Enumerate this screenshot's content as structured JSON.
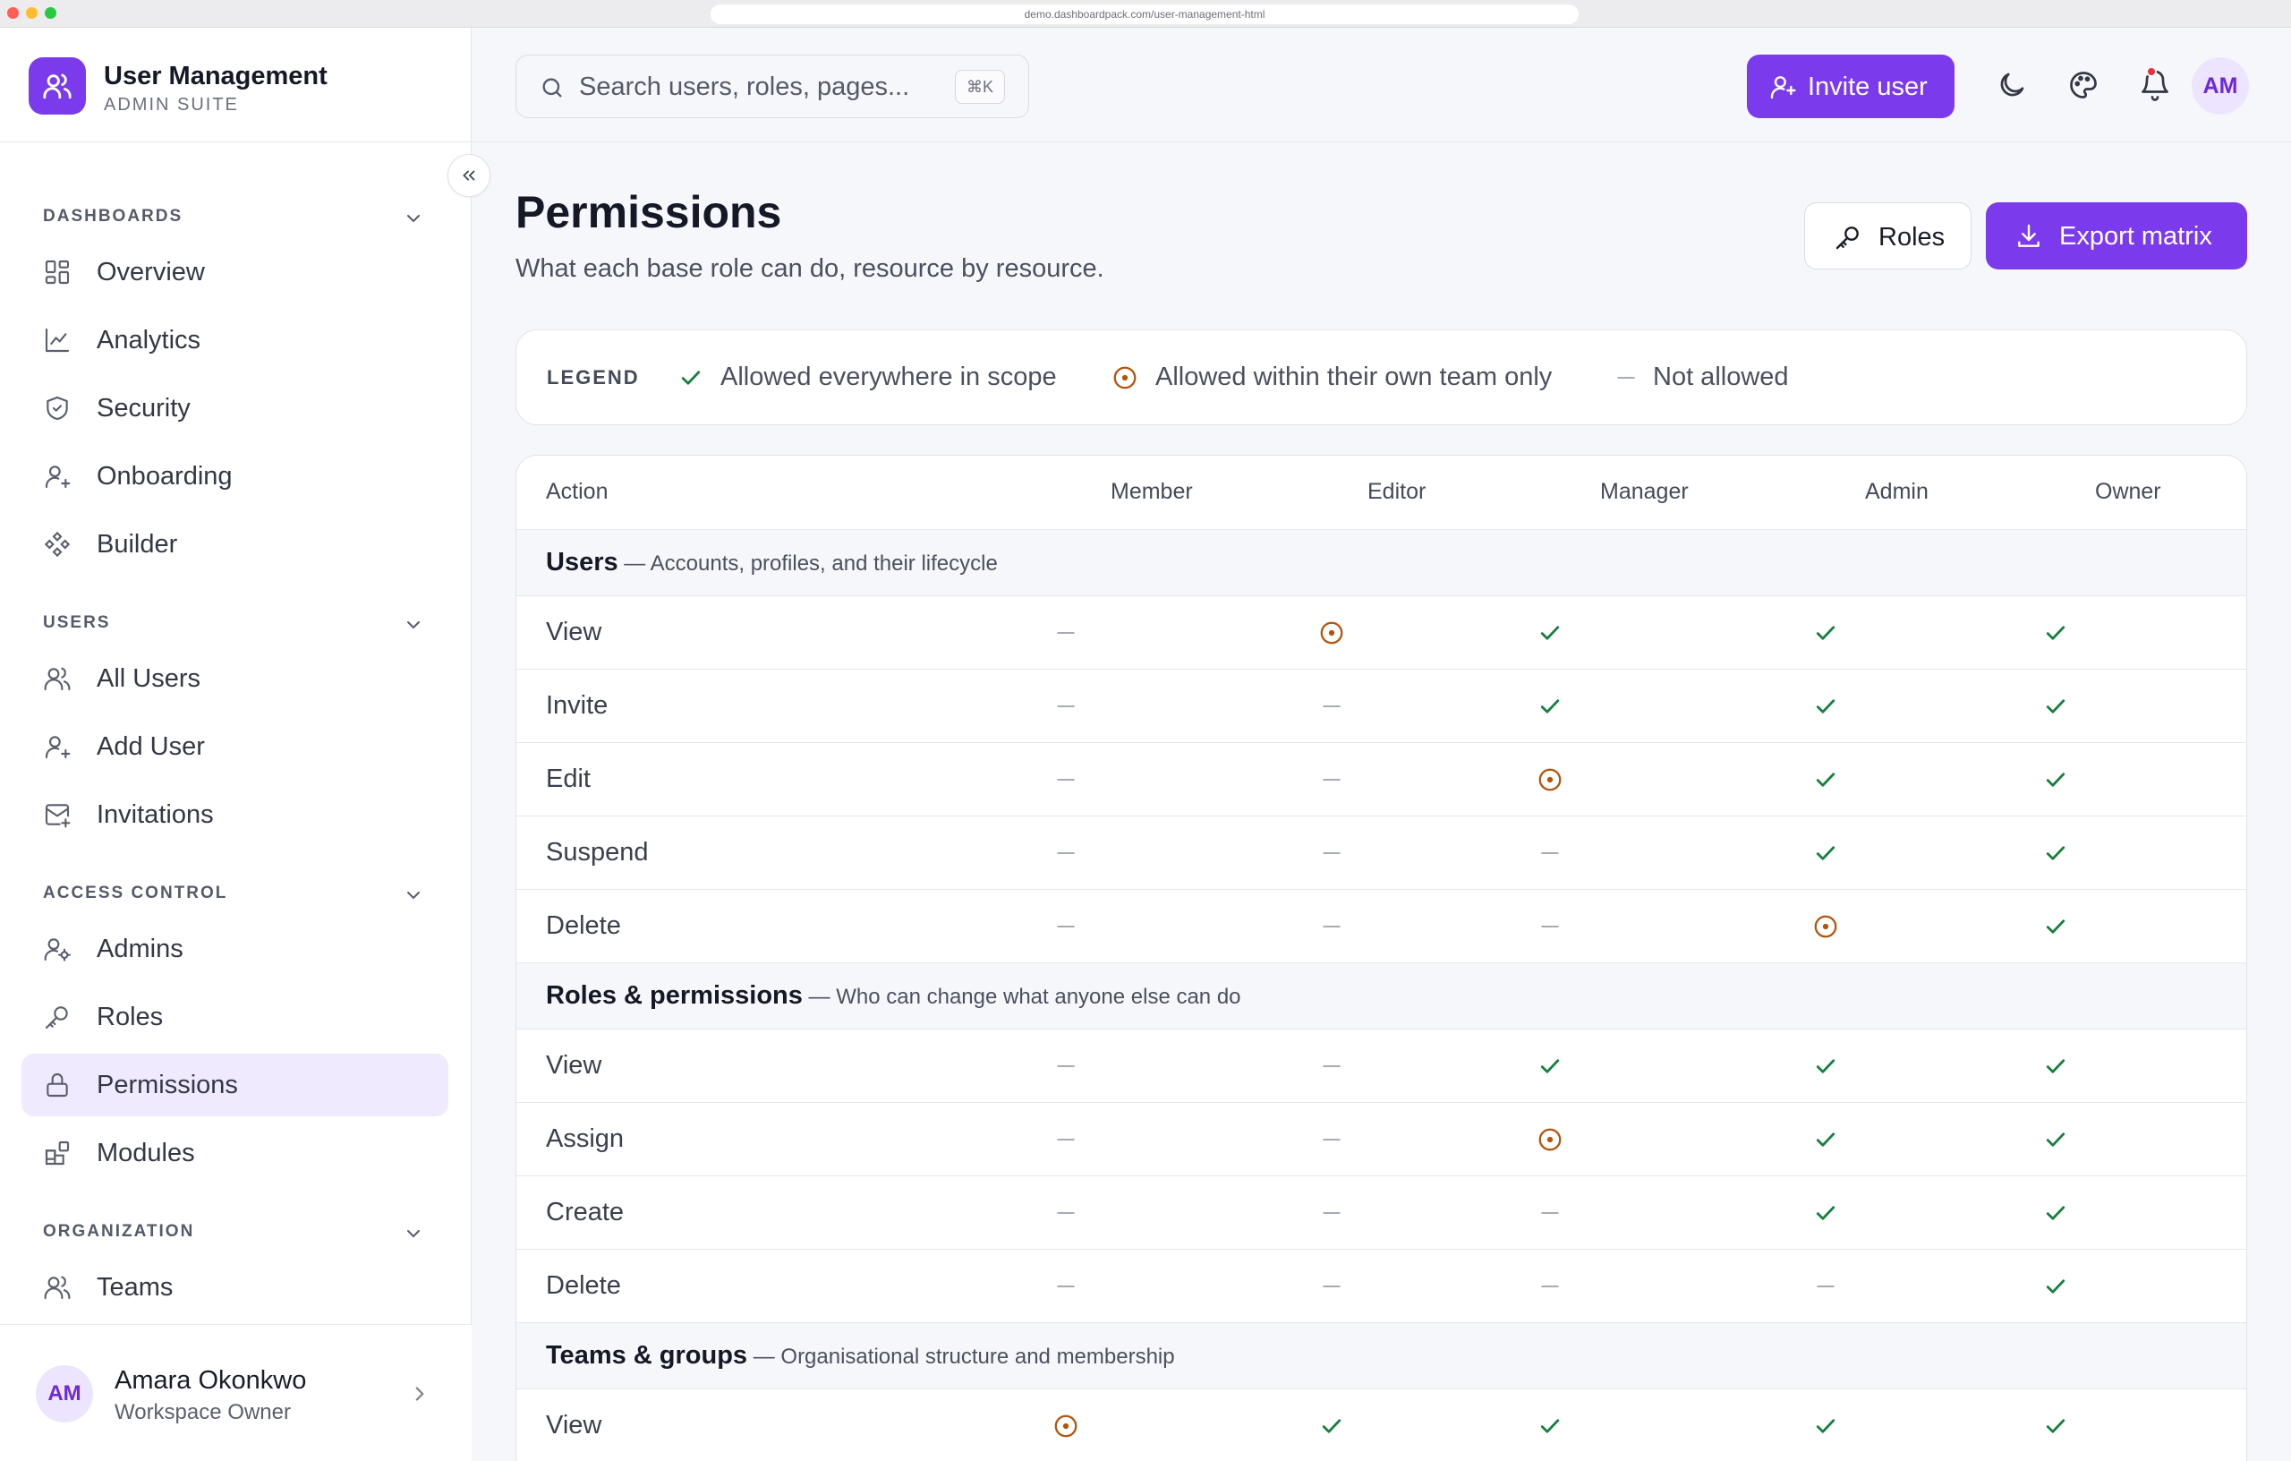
{
  "browser": {
    "url": "demo.dashboardpack.com/user-management-html"
  },
  "brand": {
    "title": "User Management",
    "subtitle": "ADMIN SUITE"
  },
  "sidebar": {
    "sections": [
      {
        "title": "DASHBOARDS",
        "items": [
          {
            "label": "Overview",
            "icon": "grid-icon"
          },
          {
            "label": "Analytics",
            "icon": "chart-line-icon"
          },
          {
            "label": "Security",
            "icon": "shield-icon"
          },
          {
            "label": "Onboarding",
            "icon": "user-plus-icon"
          },
          {
            "label": "Builder",
            "icon": "components-icon"
          }
        ]
      },
      {
        "title": "USERS",
        "items": [
          {
            "label": "All Users",
            "icon": "users-icon"
          },
          {
            "label": "Add User",
            "icon": "user-plus-icon"
          },
          {
            "label": "Invitations",
            "icon": "mail-icon"
          }
        ]
      },
      {
        "title": "ACCESS CONTROL",
        "items": [
          {
            "label": "Admins",
            "icon": "user-cog-icon"
          },
          {
            "label": "Roles",
            "icon": "key-icon"
          },
          {
            "label": "Permissions",
            "icon": "lock-icon",
            "active": true
          },
          {
            "label": "Modules",
            "icon": "blocks-icon"
          }
        ]
      },
      {
        "title": "ORGANIZATION",
        "items": [
          {
            "label": "Teams",
            "icon": "users-icon"
          }
        ]
      }
    ],
    "footer": {
      "initials": "AM",
      "name": "Amara Okonkwo",
      "role": "Workspace Owner"
    }
  },
  "topbar": {
    "search": {
      "placeholder": "Search users, roles, pages...",
      "shortcut": "⌘K"
    },
    "invite_label": "Invite user",
    "avatar_initials": "AM"
  },
  "page": {
    "title": "Permissions",
    "subtitle": "What each base role can do, resource by resource.",
    "roles_button": "Roles",
    "export_button": "Export matrix"
  },
  "legend": {
    "heading": "LEGEND",
    "allowed": "Allowed everywhere in scope",
    "team": "Allowed within their own team only",
    "none": "Not allowed"
  },
  "matrix": {
    "action_header": "Action",
    "roles": [
      "Member",
      "Editor",
      "Manager",
      "Admin",
      "Owner"
    ],
    "groups": [
      {
        "name": "Users",
        "desc": " — Accounts, profiles, and their lifecycle",
        "rows": [
          {
            "action": "View",
            "values": [
              "none",
              "team",
              "allowed",
              "allowed",
              "allowed"
            ]
          },
          {
            "action": "Invite",
            "values": [
              "none",
              "none",
              "allowed",
              "allowed",
              "allowed"
            ]
          },
          {
            "action": "Edit",
            "values": [
              "none",
              "none",
              "team",
              "allowed",
              "allowed"
            ]
          },
          {
            "action": "Suspend",
            "values": [
              "none",
              "none",
              "none",
              "allowed",
              "allowed"
            ]
          },
          {
            "action": "Delete",
            "values": [
              "none",
              "none",
              "none",
              "team",
              "allowed"
            ]
          }
        ]
      },
      {
        "name": "Roles & permissions",
        "desc": " — Who can change what anyone else can do",
        "rows": [
          {
            "action": "View",
            "values": [
              "none",
              "none",
              "allowed",
              "allowed",
              "allowed"
            ]
          },
          {
            "action": "Assign",
            "values": [
              "none",
              "none",
              "team",
              "allowed",
              "allowed"
            ]
          },
          {
            "action": "Create",
            "values": [
              "none",
              "none",
              "none",
              "allowed",
              "allowed"
            ]
          },
          {
            "action": "Delete",
            "values": [
              "none",
              "none",
              "none",
              "none",
              "allowed"
            ]
          }
        ]
      },
      {
        "name": "Teams & groups",
        "desc": " — Organisational structure and membership",
        "rows": [
          {
            "action": "View",
            "values": [
              "team",
              "allowed",
              "allowed",
              "allowed",
              "allowed"
            ]
          }
        ]
      }
    ]
  },
  "colors": {
    "accent": "#7c3aed",
    "allowed": "#15803d",
    "team": "#b45309",
    "none": "#a7abb6"
  }
}
